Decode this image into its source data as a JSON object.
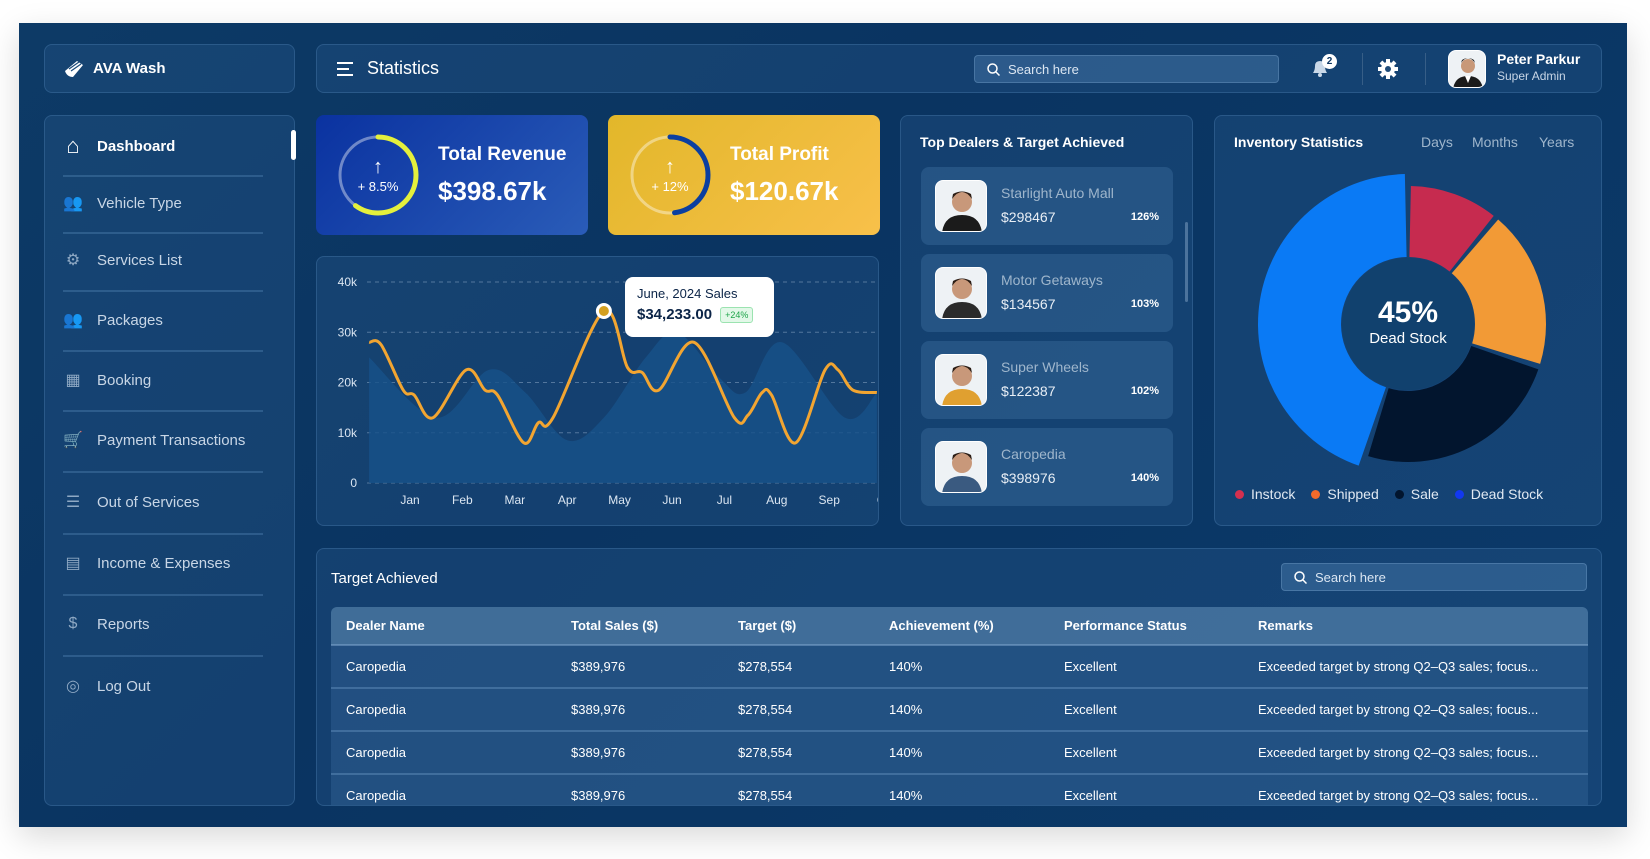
{
  "brand": {
    "name": "AVA Wash",
    "icon": "brush-wing-icon"
  },
  "header": {
    "title": "Statistics",
    "search_placeholder": "Search here",
    "notification_count": "2",
    "user": {
      "name": "Peter Parkur",
      "role": "Super Admin"
    }
  },
  "sidebar": {
    "items": [
      {
        "label": "Dashboard",
        "icon": "home-icon",
        "active": true
      },
      {
        "label": "Vehicle Type",
        "icon": "users-group-icon"
      },
      {
        "label": "Services List",
        "icon": "gear-icon"
      },
      {
        "label": "Packages",
        "icon": "users-icon"
      },
      {
        "label": "Booking",
        "icon": "grid-gear-icon"
      },
      {
        "label": "Payment Transactions",
        "icon": "cart-icon"
      },
      {
        "label": "Out of Services",
        "icon": "list-icon"
      },
      {
        "label": "Income & Expenses",
        "icon": "document-icon"
      },
      {
        "label": "Reports",
        "icon": "money-bag-icon"
      },
      {
        "label": "Log Out",
        "icon": "lifebuoy-icon"
      }
    ]
  },
  "kpis": [
    {
      "title": "Total Revenue",
      "value": "$398.67k",
      "change": "+ 8.5%",
      "progress": 0.6,
      "ring_color": "#e4f03c"
    },
    {
      "title": "Total Profit",
      "value": "$120.67k",
      "change": "+ 12%",
      "progress": 0.48,
      "ring_color": "#0b3fa0"
    }
  ],
  "chart_data": {
    "type": "line",
    "x_ticks": [
      "Jan",
      "Feb",
      "Mar",
      "Apr",
      "May",
      "Jun",
      "Jul",
      "Aug",
      "Sep",
      "O"
    ],
    "y_ticks": [
      "0",
      "10k",
      "20k",
      "30k",
      "40k"
    ],
    "ylim": [
      0,
      40000
    ],
    "grid": true,
    "series": [
      {
        "color": "#f2a531",
        "points": [
          [
            0.22,
            28000
          ],
          [
            0.45,
            27500
          ],
          [
            0.87,
            18500
          ],
          [
            1.08,
            17500
          ],
          [
            1.44,
            13000
          ],
          [
            2.07,
            22500
          ],
          [
            2.43,
            18500
          ],
          [
            2.67,
            17500
          ],
          [
            3.17,
            8000
          ],
          [
            3.45,
            12000
          ],
          [
            3.73,
            13000
          ],
          [
            4.7,
            34233
          ],
          [
            5.15,
            23000
          ],
          [
            5.43,
            22000
          ],
          [
            5.75,
            18500
          ],
          [
            6.42,
            28000
          ],
          [
            7.19,
            13000
          ],
          [
            7.45,
            13500
          ],
          [
            7.72,
            18000
          ],
          [
            7.9,
            17500
          ],
          [
            8.36,
            8000
          ],
          [
            8.92,
            22500
          ],
          [
            9.17,
            22500
          ],
          [
            9.45,
            18500
          ],
          [
            9.91,
            18000
          ]
        ]
      },
      {
        "color": "#175189",
        "area": true,
        "points": [
          [
            0.22,
            25000
          ],
          [
            1.5,
            13000
          ],
          [
            2.5,
            22500
          ],
          [
            3.2,
            18000
          ],
          [
            4,
            8500
          ],
          [
            4.7,
            13000
          ],
          [
            5.5,
            25000
          ],
          [
            6.1,
            30000
          ],
          [
            6.9,
            21000
          ],
          [
            7.4,
            18000
          ],
          [
            8.1,
            28000
          ],
          [
            9.3,
            13000
          ],
          [
            9.91,
            18000
          ]
        ]
      }
    ],
    "tooltip": {
      "title": "June, 2024 Sales",
      "value": "$34,233.00",
      "change": "+24%"
    }
  },
  "dealers": {
    "title": "Top Dealers & Target Achieved",
    "items": [
      {
        "name": "Starlight Auto Mall",
        "sales": "$298467",
        "pct": "126%",
        "shirt": "#1b1b1b"
      },
      {
        "name": "Motor Getaways",
        "sales": "$134567",
        "pct": "103%",
        "shirt": "#2b2b2b"
      },
      {
        "name": "Super Wheels",
        "sales": "$122387",
        "pct": "102%",
        "shirt": "#e0a030"
      },
      {
        "name": "Caropedia",
        "sales": "$398976",
        "pct": "140%",
        "shirt": "#3a5a80"
      }
    ]
  },
  "inventory": {
    "title": "Inventory Statistics",
    "periods": [
      "Days",
      "Months",
      "Years"
    ],
    "center_value": "45%",
    "center_label": "Dead Stock",
    "chart_data": {
      "type": "pie",
      "slices": [
        {
          "label": "Instock",
          "value": 11,
          "color": "#c62b4f",
          "legend_color": "#d4304f"
        },
        {
          "label": "Shipped",
          "value": 19,
          "color": "#f29a36",
          "legend_color": "#f26a2a"
        },
        {
          "label": "Sale",
          "value": 25,
          "color": "#02152e",
          "legend_color": "#02152e"
        },
        {
          "label": "Dead Stock",
          "value": 45,
          "color": "#0a7af5",
          "legend_color": "#1238f0"
        }
      ]
    }
  },
  "target": {
    "title": "Target Achieved",
    "search_placeholder": "Search here",
    "columns": [
      "Dealer Name",
      "Total Sales ($)",
      "Target ($)",
      "Achievement (%)",
      "Performance Status",
      "Remarks"
    ],
    "rows": [
      [
        "Caropedia",
        "$389,976",
        "$278,554",
        "140%",
        "Excellent",
        "Exceeded target by strong Q2–Q3 sales; focus..."
      ],
      [
        "Caropedia",
        "$389,976",
        "$278,554",
        "140%",
        "Excellent",
        "Exceeded target by strong Q2–Q3 sales; focus..."
      ],
      [
        "Caropedia",
        "$389,976",
        "$278,554",
        "140%",
        "Excellent",
        "Exceeded target by strong Q2–Q3 sales; focus..."
      ],
      [
        "Caropedia",
        "$389,976",
        "$278,554",
        "140%",
        "Excellent",
        "Exceeded target by strong Q2–Q3 sales; focus..."
      ]
    ]
  }
}
